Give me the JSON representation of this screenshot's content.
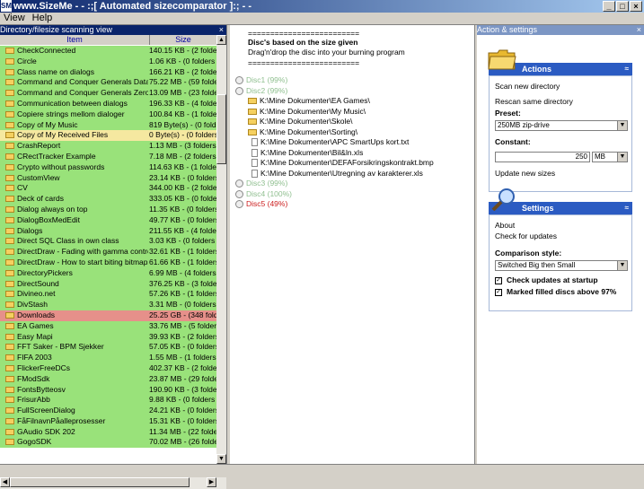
{
  "window": {
    "icon_text": "SM",
    "title": "www.SizeMe - - :;[ Automated sizecomparator ]:; - -",
    "buttons": {
      "minimize": "_",
      "maximize": "□",
      "close": "×"
    }
  },
  "menu": {
    "items": [
      "View",
      "Help"
    ]
  },
  "left_panel": {
    "header": "Directory/filesize scanning view",
    "close": "×",
    "columns": {
      "item": "Item",
      "size": "Size"
    },
    "rows": [
      {
        "name": "CheckConnected",
        "size": "140.15 KB - (2 folders",
        "color": "#99e27a"
      },
      {
        "name": "Circle",
        "size": "1.06 KB - (0 folders an",
        "color": "#99e27a"
      },
      {
        "name": "Class name on dialogs",
        "size": "166.21 KB - (2 folders",
        "color": "#99e27a"
      },
      {
        "name": "Command and Conquer Generals Data",
        "size": "75.22 MB - (59 folders",
        "color": "#99e27a"
      },
      {
        "name": "Command and Conquer Generals Zero Hour",
        "size": "13.09 MB - (23 folders",
        "color": "#99e27a"
      },
      {
        "name": "Communication between dialogs",
        "size": "196.33 KB - (4 folders",
        "color": "#99e27a"
      },
      {
        "name": "Copiere strings mellom dialoger",
        "size": "100.84 KB - (1 folders",
        "color": "#99e27a"
      },
      {
        "name": "Copy of My Music",
        "size": "819 Byte(s) - (0 folder",
        "color": "#99e27a"
      },
      {
        "name": "Copy of My Received Files",
        "size": "0 Byte(s) - (0 folders a",
        "color": "#f5e8a0"
      },
      {
        "name": "CrashReport",
        "size": "1.13 MB - (3 folders ar",
        "color": "#99e27a"
      },
      {
        "name": "CRectTracker Example",
        "size": "7.18 MB - (2 folders ar",
        "color": "#99e27a"
      },
      {
        "name": "Crypto without passwords",
        "size": "114.63 KB - (1 folders",
        "color": "#99e27a"
      },
      {
        "name": "CustomView",
        "size": "23.14 KB - (0 folders a",
        "color": "#99e27a"
      },
      {
        "name": "CV",
        "size": "344.00 KB - (2 folders",
        "color": "#99e27a"
      },
      {
        "name": "Deck of cards",
        "size": "333.05 KB - (0 folders",
        "color": "#99e27a"
      },
      {
        "name": "Dialog always on top",
        "size": "11.35 KB - (0 folders a",
        "color": "#99e27a"
      },
      {
        "name": "DialogBoxMedEdit",
        "size": "49.77 KB - (0 folders a",
        "color": "#99e27a"
      },
      {
        "name": "Dialogs",
        "size": "211.55 KB - (4 folders",
        "color": "#99e27a"
      },
      {
        "name": "Direct SQL Class in own class",
        "size": "3.03 KB - (0 folders an",
        "color": "#99e27a"
      },
      {
        "name": "DirectDraw - Fading with gamma controls",
        "size": "32.61 KB - (1 folders a",
        "color": "#99e27a"
      },
      {
        "name": "DirectDraw - How to start biting bitmaps",
        "size": "61.66 KB - (1 folders a",
        "color": "#99e27a"
      },
      {
        "name": "DirectoryPickers",
        "size": "6.99 MB - (4 folders ar",
        "color": "#99e27a"
      },
      {
        "name": "DirectSound",
        "size": "376.25 KB - (3 folders",
        "color": "#99e27a"
      },
      {
        "name": "Divineo.net",
        "size": "57.26 KB - (1 folders a",
        "color": "#99e27a"
      },
      {
        "name": "DivStash",
        "size": "3.31 MB - (0 folders ar",
        "color": "#99e27a"
      },
      {
        "name": "Downloads",
        "size": "25.25 GB - (348 folder",
        "color": "#e6908a"
      },
      {
        "name": "EA Games",
        "size": "33.76 MB - (5 folders a",
        "color": "#99e27a"
      },
      {
        "name": "Easy Mapi",
        "size": "39.93 KB - (2 folders a",
        "color": "#99e27a"
      },
      {
        "name": "FFT Saker - BPM Sjekker",
        "size": "57.05 KB - (0 folders a",
        "color": "#99e27a"
      },
      {
        "name": "FIFA 2003",
        "size": "1.55 MB - (1 folders ar",
        "color": "#99e27a"
      },
      {
        "name": "FlickerFreeDCs",
        "size": "402.37 KB - (2 folders",
        "color": "#99e27a"
      },
      {
        "name": "FModSdk",
        "size": "23.87 MB - (29 folders",
        "color": "#99e27a"
      },
      {
        "name": "FontsBytteosv",
        "size": "190.90 KB - (3 folders",
        "color": "#99e27a"
      },
      {
        "name": "FrisurAbb",
        "size": "9.88 KB - (0 folders an",
        "color": "#99e27a"
      },
      {
        "name": "FullScreenDialog",
        "size": "24.21 KB - (0 folders a",
        "color": "#99e27a"
      },
      {
        "name": "FåFilnavnPåalleprosesser",
        "size": "15.31 KB - (0 folders a",
        "color": "#99e27a"
      },
      {
        "name": "GAudio SDK 202",
        "size": "11.34 MB - (22 folders",
        "color": "#99e27a"
      },
      {
        "name": "GogoSDK",
        "size": "70.02 MB - (26 folders",
        "color": "#99e27a"
      }
    ]
  },
  "middle_panel": {
    "lines": [
      "=========================",
      "Disc's based on the size given",
      "Drag'n'drop the disc into your burning program",
      "========================="
    ],
    "discs": [
      {
        "label": "Disc1 (99%)",
        "color": "#8fbf8f"
      },
      {
        "label": "Disc2 (99%)",
        "color": "#8fbf8f"
      },
      {
        "label": "Disc3 (99%)",
        "color": "#8fbf8f"
      },
      {
        "label": "Disc4 (100%)",
        "color": "#8fbf8f"
      },
      {
        "label": "Disc5 (49%)",
        "color": "#cc2020"
      }
    ],
    "disc2_children": [
      {
        "type": "folder",
        "label": "K:\\Mine Dokumenter\\EA Games\\"
      },
      {
        "type": "folder",
        "label": "K:\\Mine Dokumenter\\My Music\\"
      },
      {
        "type": "folder",
        "label": "K:\\Mine Dokumenter\\Skole\\"
      },
      {
        "type": "folder",
        "label": "K:\\Mine Dokumenter\\Sorting\\"
      },
      {
        "type": "file",
        "label": "K:\\Mine Dokumenter\\APC SmartUps kort.txt"
      },
      {
        "type": "file",
        "label": "K:\\Mine Dokumenter\\Bil&ln.xls"
      },
      {
        "type": "file",
        "label": "K:\\Mine Dokumenter\\DEFAForsikringskontrakt.bmp"
      },
      {
        "type": "file",
        "label": "K:\\Mine Dokumenter\\Utregning av karakterer.xls"
      }
    ]
  },
  "right_panel": {
    "header": "Action & settings",
    "close": "×",
    "actions": {
      "title": "Actions",
      "collapse": "≈",
      "scan": "Scan new directory",
      "rescan": "Rescan same directory",
      "preset_label": "Preset:",
      "preset_value": "250MB zip-drive",
      "constant_label": "Constant:",
      "constant_value": "250",
      "unit_value": "MB",
      "update": "Update new sizes"
    },
    "settings": {
      "title": "Settings",
      "collapse": "≈",
      "about": "About",
      "check_updates": "Check for updates",
      "comparison_label": "Comparison style:",
      "comparison_value": "Switched Big then Small",
      "check1_label": "Check updates at startup",
      "check1_checked": "✓",
      "check2_label": "Marked filled discs above 97%",
      "check2_checked": "✓"
    }
  },
  "icons": {
    "folder": "folder-icon",
    "file": "file-icon",
    "disc": "disc-icon"
  }
}
